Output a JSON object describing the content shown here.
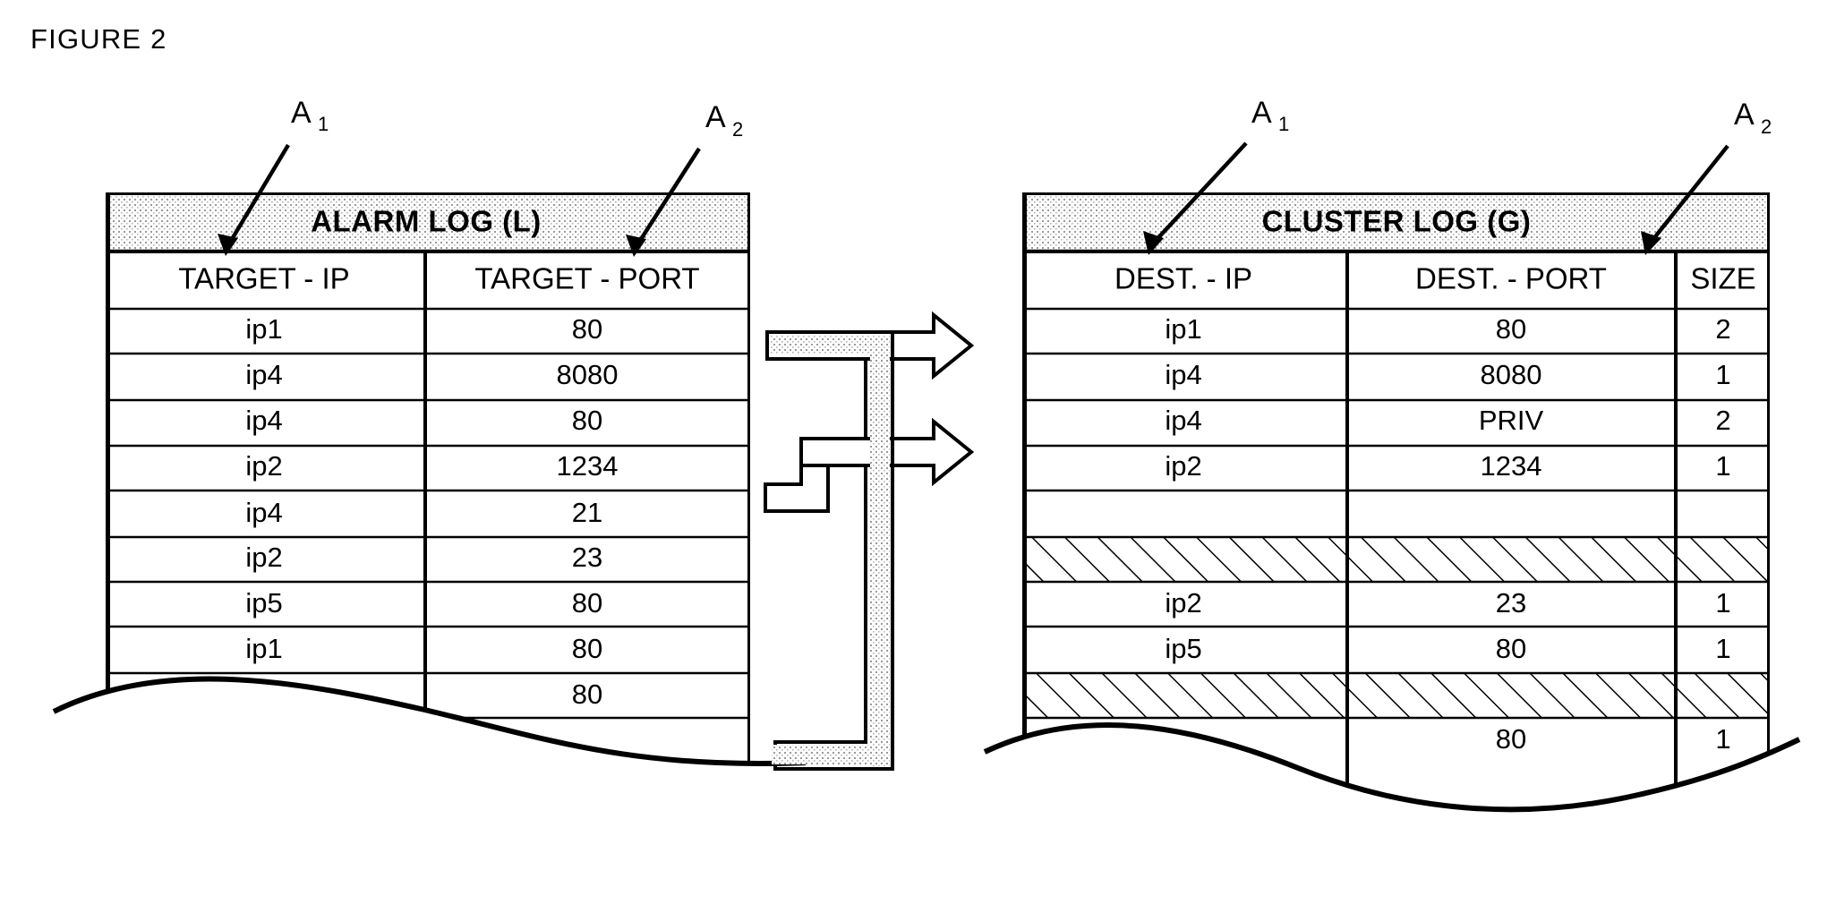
{
  "figure": {
    "title": "FIGURE 2"
  },
  "callouts": [
    {
      "name": "A1-left",
      "base": "A",
      "sub": "1"
    },
    {
      "name": "A2-left",
      "base": "A",
      "sub": "2"
    },
    {
      "name": "A1-right",
      "base": "A",
      "sub": "1"
    },
    {
      "name": "A2-right",
      "base": "A",
      "sub": "2"
    }
  ],
  "tables": {
    "alarm_log": {
      "band_title": "ALARM LOG (L)",
      "columns": [
        "TARGET - IP",
        "TARGET - PORT"
      ],
      "rows": [
        {
          "ip": "ip1",
          "port": "80"
        },
        {
          "ip": "ip4",
          "port": "8080"
        },
        {
          "ip": "ip4",
          "port": "80"
        },
        {
          "ip": "ip2",
          "port": "1234"
        },
        {
          "ip": "ip4",
          "port": "21"
        },
        {
          "ip": "ip2",
          "port": "23"
        },
        {
          "ip": "ip5",
          "port": "80"
        },
        {
          "ip": "ip1",
          "port": "80"
        },
        {
          "ip": "",
          "port": "80"
        }
      ]
    },
    "cluster_log": {
      "band_title": "CLUSTER LOG (G)",
      "columns": [
        "DEST. - IP",
        "DEST. - PORT",
        "SIZE"
      ],
      "rows": [
        {
          "ip": "ip1",
          "port": "80",
          "size": "2",
          "hatched": false
        },
        {
          "ip": "ip4",
          "port": "8080",
          "size": "1",
          "hatched": false
        },
        {
          "ip": "ip4",
          "port": "PRIV",
          "size": "2",
          "hatched": false
        },
        {
          "ip": "ip2",
          "port": "1234",
          "size": "1",
          "hatched": false
        },
        {
          "ip": "",
          "port": "",
          "size": "",
          "hatched": true
        },
        {
          "ip": "ip2",
          "port": "23",
          "size": "1",
          "hatched": false
        },
        {
          "ip": "ip5",
          "port": "80",
          "size": "1",
          "hatched": false
        },
        {
          "ip": "",
          "port": "",
          "size": "",
          "hatched": true
        },
        {
          "ip": "",
          "port": "80",
          "size": "1",
          "hatched": false
        }
      ]
    }
  },
  "connector": {
    "name": "arrow-manifold",
    "arrow_count": 2,
    "description": "hollow outlined arrows from alarm log to cluster log"
  },
  "colors": {
    "ink": "#000000",
    "paper": "#ffffff",
    "band_shade": "#d9d9d9"
  }
}
